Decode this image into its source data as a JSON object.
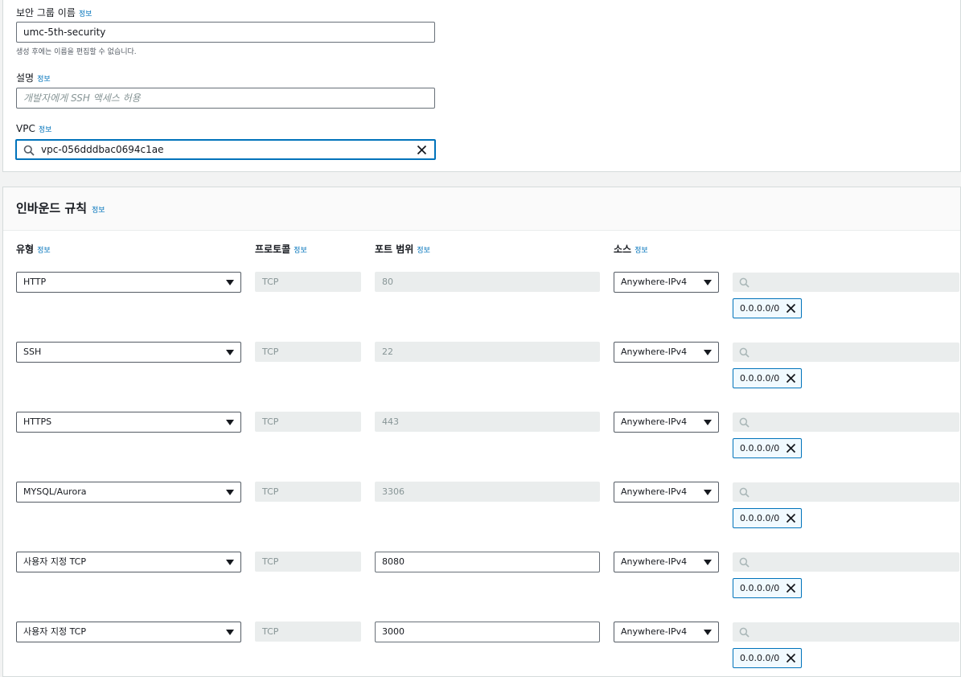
{
  "basic": {
    "name_label": "보안 그룹 이름",
    "name_info": "정보",
    "name_value": "umc-5th-security",
    "name_hint": "생성 후에는 이름을 편집할 수 없습니다.",
    "desc_label": "설명",
    "desc_info": "정보",
    "desc_placeholder": "개발자에게 SSH 액세스 허용",
    "vpc_label": "VPC",
    "vpc_info": "정보",
    "vpc_value": "vpc-056dddbac0694c1ae"
  },
  "inbound": {
    "title": "인바운드 규칙",
    "title_info": "정보",
    "headers": {
      "type": "유형",
      "type_info": "정보",
      "protocol": "프로토콜",
      "protocol_info": "정보",
      "port": "포트 범위",
      "port_info": "정보",
      "source": "소스",
      "source_info": "정보"
    },
    "rules": [
      {
        "type": "HTTP",
        "protocol": "TCP",
        "port": "80",
        "source": "Anywhere-IPv4",
        "cidr": "0.0.0.0/0"
      },
      {
        "type": "SSH",
        "protocol": "TCP",
        "port": "22",
        "source": "Anywhere-IPv4",
        "cidr": "0.0.0.0/0"
      },
      {
        "type": "HTTPS",
        "protocol": "TCP",
        "port": "443",
        "source": "Anywhere-IPv4",
        "cidr": "0.0.0.0/0"
      },
      {
        "type": "MYSQL/Aurora",
        "protocol": "TCP",
        "port": "3306",
        "source": "Anywhere-IPv4",
        "cidr": "0.0.0.0/0"
      },
      {
        "type": "사용자 지정 TCP",
        "protocol": "TCP",
        "port": "8080",
        "source": "Anywhere-IPv4",
        "cidr": "0.0.0.0/0"
      },
      {
        "type": "사용자 지정 TCP",
        "protocol": "TCP",
        "port": "3000",
        "source": "Anywhere-IPv4",
        "cidr": "0.0.0.0/0"
      }
    ]
  }
}
